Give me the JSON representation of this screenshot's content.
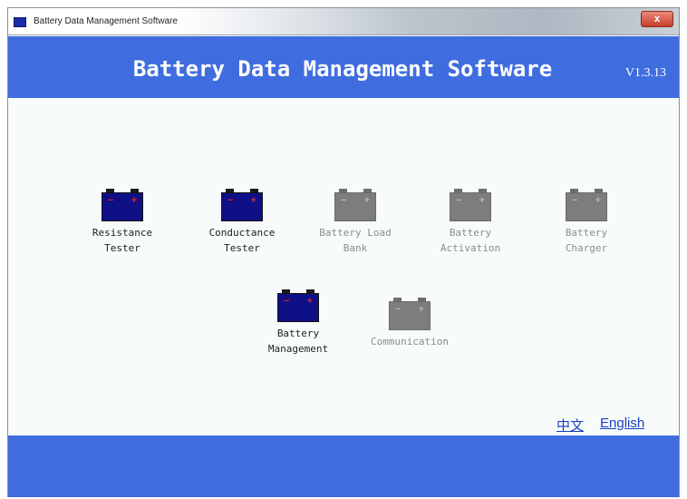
{
  "window": {
    "title": "Battery Data Management Software",
    "close_label": "x"
  },
  "header": {
    "title": "Battery Data Management Software",
    "version": "V1.3.13"
  },
  "modules": [
    {
      "label": "Resistance\nTester",
      "enabled": true
    },
    {
      "label": "Conductance\nTester",
      "enabled": true
    },
    {
      "label": "Battery Load\nBank",
      "enabled": false
    },
    {
      "label": "Battery\nActivation",
      "enabled": false
    },
    {
      "label": "Battery\nCharger",
      "enabled": false
    },
    {
      "label": "Battery\nManagement",
      "enabled": true
    },
    {
      "label": "Communication",
      "enabled": false
    }
  ],
  "language": {
    "chinese": "中文",
    "english": "English"
  },
  "colors": {
    "accent": "#3f6de0",
    "active_battery": "#0f0f86",
    "disabled_battery": "#7d7d7d",
    "link": "#1a3fc0"
  }
}
